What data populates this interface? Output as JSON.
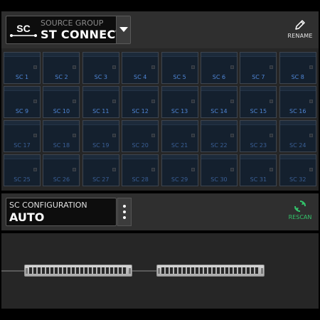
{
  "source_group": {
    "label": "SOURCE GROUP",
    "value": "ST CONNECT",
    "logo_text": "SC"
  },
  "rename": {
    "label": "RENAME"
  },
  "grid": {
    "tiles": [
      "SC 1",
      "SC 2",
      "SC 3",
      "SC 4",
      "SC 5",
      "SC 6",
      "SC 7",
      "SC 8",
      "SC 9",
      "SC 10",
      "SC 11",
      "SC 12",
      "SC 13",
      "SC 14",
      "SC 15",
      "SC 16",
      "SC 17",
      "SC 18",
      "SC 19",
      "SC 20",
      "SC 21",
      "SC 22",
      "SC 23",
      "SC 24",
      "SC 25",
      "SC 26",
      "SC 27",
      "SC 28",
      "SC 29",
      "SC 30",
      "SC 31",
      "SC 32"
    ]
  },
  "config": {
    "label": "SC CONFIGURATION",
    "value": "AUTO"
  },
  "rescan": {
    "label": "RESCAN"
  },
  "colors": {
    "accent_blue": "#4f86d6",
    "rescan_green": "#33c26a"
  },
  "devices": [
    "rack-unit-1",
    "rack-unit-2"
  ]
}
